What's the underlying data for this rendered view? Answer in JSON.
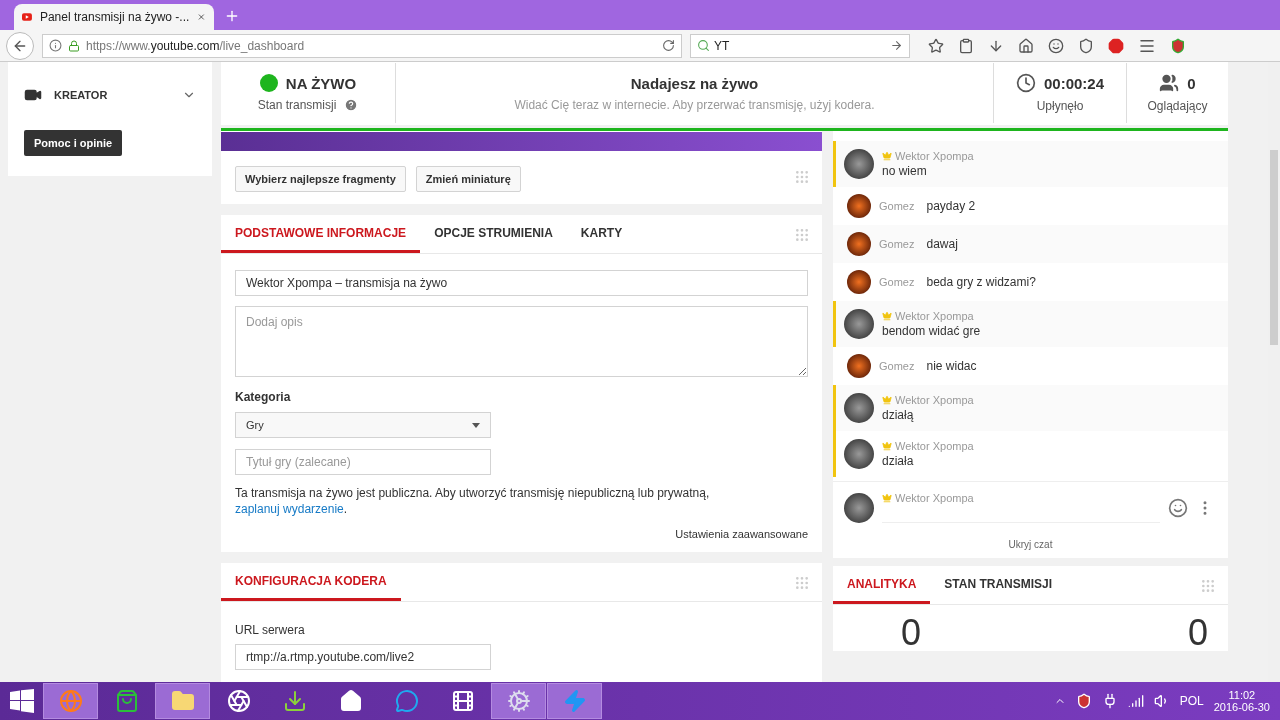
{
  "browser": {
    "tab": {
      "title": "Panel transmisji na żywo -...",
      "selected": true
    },
    "url": "https://www.**youtube.com**/live_dashboard",
    "search": "YT"
  },
  "sidebar": {
    "items": [
      {
        "label": "KREATOR",
        "expanded": false
      }
    ],
    "help_button": "Pomoc i opinie"
  },
  "status": {
    "live": true,
    "state": "NA ŻYWO",
    "state_label": "Stan transmisji",
    "title": "Nadajesz na żywo",
    "subtitle": "Widać Cię teraz w internecie. Aby przerwać transmisję, użyj kodera.",
    "elapsed": "00:00:24",
    "elapsed_label": "Upłynęło",
    "viewers": "0",
    "viewers_label": "Oglądający"
  },
  "preview_buttons": [
    "Wybierz najlepsze fragmenty",
    "Zmień miniaturę"
  ],
  "info_card": {
    "tabs": [
      {
        "label": "PODSTAWOWE INFORMACJE",
        "selected": true
      },
      {
        "label": "OPCJE STRUMIENIA",
        "selected": false
      },
      {
        "label": "KARTY",
        "selected": false
      }
    ],
    "title_value": "Wektor Xpompa – transmisja na żywo",
    "description_placeholder": "Dodaj opis",
    "category_label": "Kategoria",
    "category": "Gry",
    "game_placeholder": "Tytuł gry (zalecane)",
    "notice": "Ta transmisja na żywo jest publiczna. Aby utworzyć transmisję niepubliczną lub prywatną,",
    "notice_link": "zaplanuj wydarzenie",
    "notice_end": ".",
    "advanced": "Ustawienia zaawansowane"
  },
  "encoder_card": {
    "tabs": [
      {
        "label": "KONFIGURACJA KODERA",
        "selected": true
      }
    ],
    "server_label": "URL serwera",
    "server_value": "rtmp://a.rtmp.youtube.com/live2"
  },
  "chat": {
    "messages": [
      {
        "kind": "owner",
        "author": "Wektor Xpompa",
        "text": "no wiem"
      },
      {
        "kind": "viewer",
        "author": "Gomez",
        "text": "payday 2"
      },
      {
        "kind": "viewer",
        "author": "Gomez",
        "text": "dawaj"
      },
      {
        "kind": "viewer",
        "author": "Gomez",
        "text": "beda gry z widzami?"
      },
      {
        "kind": "owner",
        "author": "Wektor Xpompa",
        "text": "bendom widać gre"
      },
      {
        "kind": "viewer",
        "author": "Gomez",
        "text": "nie widac"
      },
      {
        "kind": "owner",
        "author": "Wektor Xpompa",
        "text": "działą"
      },
      {
        "kind": "owner",
        "author": "Wektor Xpompa",
        "text": "działa"
      }
    ],
    "composer": {
      "author": "Wektor Xpompa"
    },
    "hide": "Ukryj czat"
  },
  "analytics": {
    "tabs": [
      {
        "label": "ANALITYKA",
        "selected": true
      },
      {
        "label": "STAN TRANSMISJI",
        "selected": false
      }
    ],
    "values": [
      "0",
      "0"
    ]
  },
  "taskbar": {
    "apps": [
      {
        "kind": "browser",
        "active": true
      },
      {
        "kind": "store",
        "active": false
      },
      {
        "kind": "folder",
        "active": true
      },
      {
        "kind": "recorder",
        "active": false
      },
      {
        "kind": "torrent",
        "active": false
      },
      {
        "kind": "home",
        "active": false
      },
      {
        "kind": "messenger",
        "active": false
      },
      {
        "kind": "video",
        "active": false
      },
      {
        "kind": "steam",
        "active": true
      },
      {
        "kind": "bolt",
        "active": true
      }
    ],
    "language": "POL",
    "time": "11:02",
    "date": "2016-06-30"
  }
}
